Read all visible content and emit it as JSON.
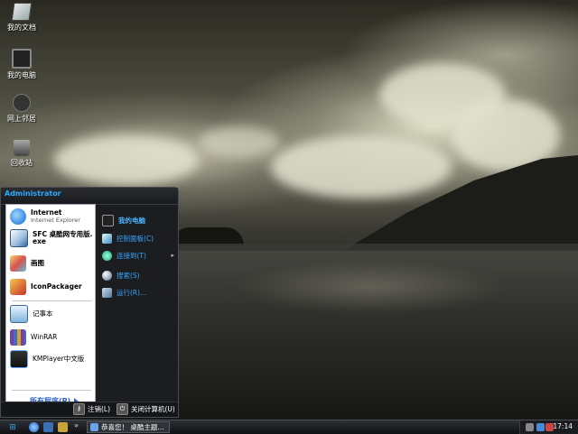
{
  "desktop": {
    "icons": [
      {
        "label": "我的文档",
        "icon": "my-documents-icon"
      },
      {
        "label": "我的电脑",
        "icon": "my-computer-icon"
      },
      {
        "label": "网上邻居",
        "icon": "network-places-icon"
      },
      {
        "label": "回收站",
        "icon": "recycle-bin-icon"
      }
    ]
  },
  "start_menu": {
    "user": "Administrator",
    "pinned": [
      {
        "title": "Internet",
        "subtitle": "Internet Explorer",
        "icon": "internet-explorer-icon"
      },
      {
        "title": "SFC 桌酷网专用版.",
        "subtitle": "exe",
        "icon": "sfc-app-icon"
      }
    ],
    "recent": [
      {
        "label": "画图",
        "icon": "paint-icon"
      },
      {
        "label": "IconPackager",
        "icon": "iconpackager-icon"
      },
      {
        "label": "记事本",
        "icon": "notepad-icon"
      },
      {
        "label": "WinRAR",
        "icon": "winrar-icon"
      },
      {
        "label": "KMPlayer中文版",
        "icon": "kmplayer-icon"
      }
    ],
    "all_programs": "所有程序(P)",
    "right": [
      {
        "label": "我的电脑",
        "icon": "my-computer-icon"
      },
      {
        "label": "控制面板(C)",
        "icon": "control-panel-icon"
      },
      {
        "label": "连接到(T)",
        "icon": "connect-to-icon",
        "has_submenu": true
      },
      {
        "label": "搜索(S)",
        "icon": "search-icon"
      },
      {
        "label": "运行(R)...",
        "icon": "run-icon"
      }
    ],
    "logoff": "注销(L)",
    "shutdown": "关闭计算机(U)"
  },
  "taskbar": {
    "overflow": "»",
    "task_label": "恭喜您！ 桌酷主题...",
    "clock": "17:14"
  },
  "colors": {
    "menu_accent": "#2da9ff",
    "all_programs": "#2a5ec8"
  }
}
